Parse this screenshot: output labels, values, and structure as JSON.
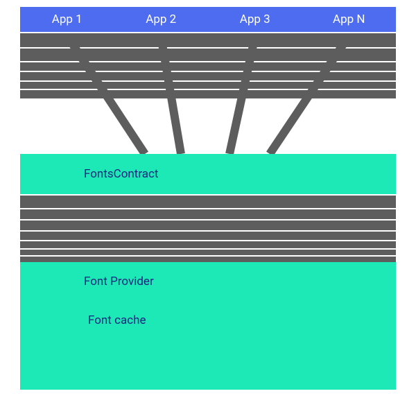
{
  "apps": [
    "App 1",
    "App 2",
    "App 3",
    "App N"
  ],
  "fonts_contract": "FontsContract",
  "font_provider": "Font Provider",
  "font_cache": "Font cache",
  "colors": {
    "app_bar": "#4e6cef",
    "stripe": "#5d5d5d",
    "green": "#1de9b6",
    "text_dark": "#1a237e",
    "text_light": "#ffffff"
  }
}
